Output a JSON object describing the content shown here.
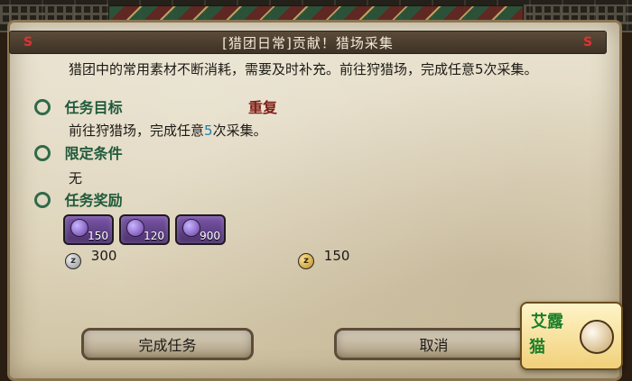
{
  "dialog": {
    "title": "[猎团日常]贡献！猎场采集",
    "description": "猎团中的常用素材不断消耗，需要及时补充。前往狩猎场，完成任意5次采集。",
    "sections": {
      "objective": {
        "title": "任务目标",
        "tag": "重复",
        "text_prefix": "前往狩猎场，完成任意",
        "count": "5",
        "text_suffix": "次采集。"
      },
      "conditions": {
        "title": "限定条件",
        "value": "无"
      },
      "rewards": {
        "title": "任务奖励",
        "items": [
          {
            "value": "150"
          },
          {
            "value": "120"
          },
          {
            "value": "900"
          }
        ],
        "currency": [
          {
            "value": "300",
            "icon": "silver-coin-icon"
          },
          {
            "value": "150",
            "icon": "gold-coin-icon"
          }
        ]
      }
    },
    "buttons": {
      "complete": "完成任务",
      "cancel": "取消"
    }
  },
  "watermark": {
    "text_top": "艾露",
    "text_bottom": "猫"
  },
  "colors": {
    "section_green": "#1f5a3b",
    "repeat_red": "#7f1d15",
    "count_blue": "#1e7fb0",
    "reward_purple": "#6a3aa3"
  }
}
